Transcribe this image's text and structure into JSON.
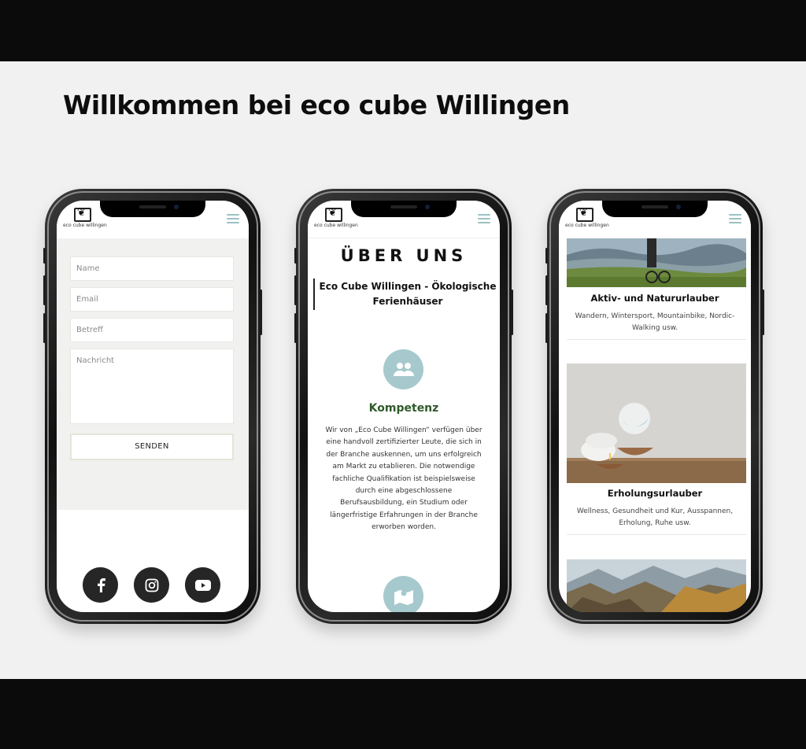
{
  "page": {
    "headline": "Willkommen bei eco cube Willingen"
  },
  "logo": {
    "text": "eco cube willingen"
  },
  "phone1": {
    "form": {
      "name_placeholder": "Name",
      "email_placeholder": "Email",
      "subject_placeholder": "Betreff",
      "message_placeholder": "Nachricht",
      "send_label": "SENDEN"
    },
    "social": [
      "facebook-icon",
      "instagram-icon",
      "youtube-icon"
    ]
  },
  "phone2": {
    "heading": "ÜBER UNS",
    "subtitle": "Eco Cube Willingen - Ökologische Ferienhäuser",
    "feature_title": "Kompetenz",
    "feature_text": "Wir von „Eco Cube Willingen“ verfügen über eine handvoll zertifizierter Leute, die sich in der Branche auskennen, um uns erfolgreich am Markt zu etablieren. Die notwendige fachliche Qualifikation ist beispielsweise durch eine abgeschlossene Berufsausbildung, ein Studium oder längerfristige Erfahrungen in der Branche erworben worden."
  },
  "phone3": {
    "cards": [
      {
        "title": "Aktiv- und Natururlauber",
        "text": "Wandern, Wintersport, Mountainbike, Nordic-Walking usw."
      },
      {
        "title": "Erholungsurlauber",
        "text": "Wellness, Gesundheit und Kur, Ausspannen, Erholung, Ruhe usw."
      }
    ]
  },
  "colors": {
    "accent": "#9cc1c4",
    "icon_bg": "#a6c9cd",
    "title_green": "#2f5a2a",
    "social_bg": "#262626"
  }
}
